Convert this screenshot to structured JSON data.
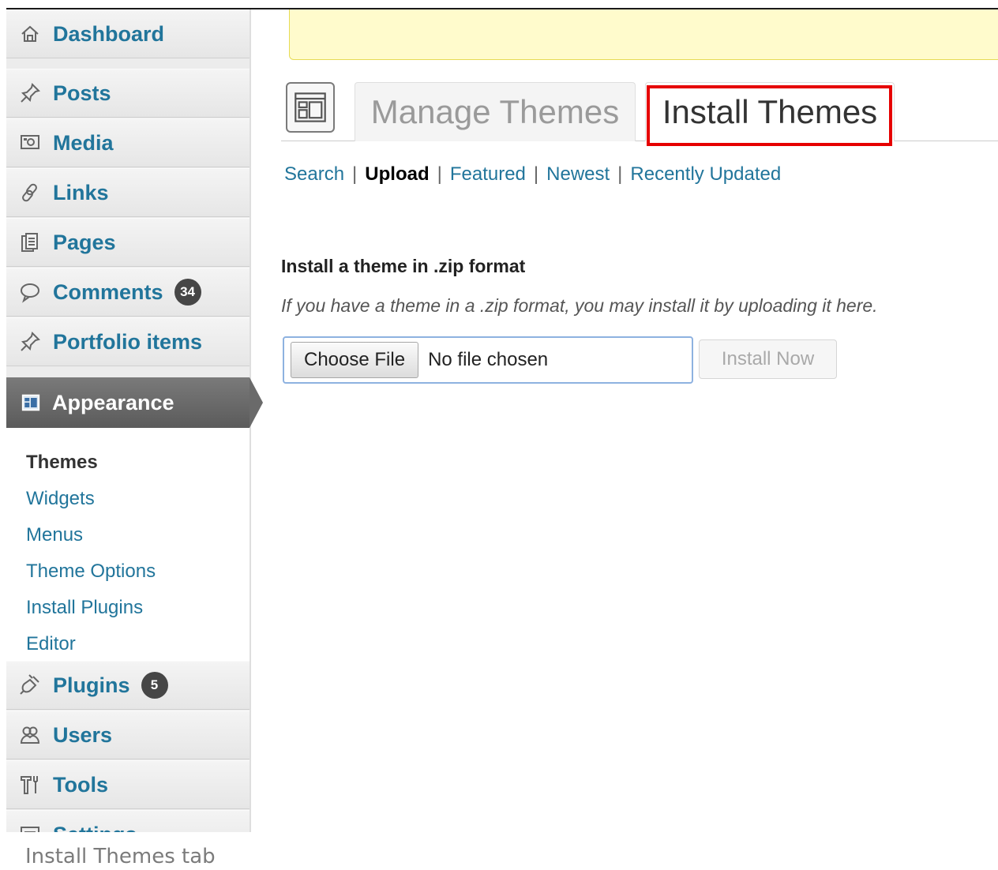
{
  "sidebar": {
    "items": [
      {
        "label": "Dashboard",
        "icon": "dashboard-icon"
      },
      {
        "label": "Posts",
        "icon": "pin-icon"
      },
      {
        "label": "Media",
        "icon": "media-icon"
      },
      {
        "label": "Links",
        "icon": "link-icon"
      },
      {
        "label": "Pages",
        "icon": "pages-icon"
      },
      {
        "label": "Comments",
        "icon": "comment-icon",
        "badge": "34"
      },
      {
        "label": "Portfolio items",
        "icon": "pin-icon"
      },
      {
        "label": "Appearance",
        "icon": "appearance-icon"
      },
      {
        "label": "Plugins",
        "icon": "plugin-icon",
        "badge": "5"
      },
      {
        "label": "Users",
        "icon": "users-icon"
      },
      {
        "label": "Tools",
        "icon": "tools-icon"
      },
      {
        "label": "Settings",
        "icon": "settings-icon"
      }
    ],
    "appearance_submenu": [
      "Themes",
      "Widgets",
      "Menus",
      "Theme Options",
      "Install Plugins",
      "Editor"
    ],
    "current_submenu": "Themes"
  },
  "tabs": {
    "manage": "Manage Themes",
    "install": "Install Themes",
    "active": "Install Themes"
  },
  "subnav": {
    "search": "Search",
    "upload": "Upload",
    "featured": "Featured",
    "newest": "Newest",
    "recently_updated": "Recently Updated",
    "current": "Upload",
    "separator": "|"
  },
  "upload": {
    "heading": "Install a theme in .zip format",
    "description": "If you have a theme in a .zip format, you may install it by uploading it here.",
    "choose_file": "Choose File",
    "no_file": "No file chosen",
    "install_now": "Install Now"
  },
  "caption": "Install Themes tab",
  "colors": {
    "link": "#21759b",
    "highlight": "#e60000",
    "notice_bg": "#fffbcc",
    "appearance_bg": "#6a6a6a"
  }
}
